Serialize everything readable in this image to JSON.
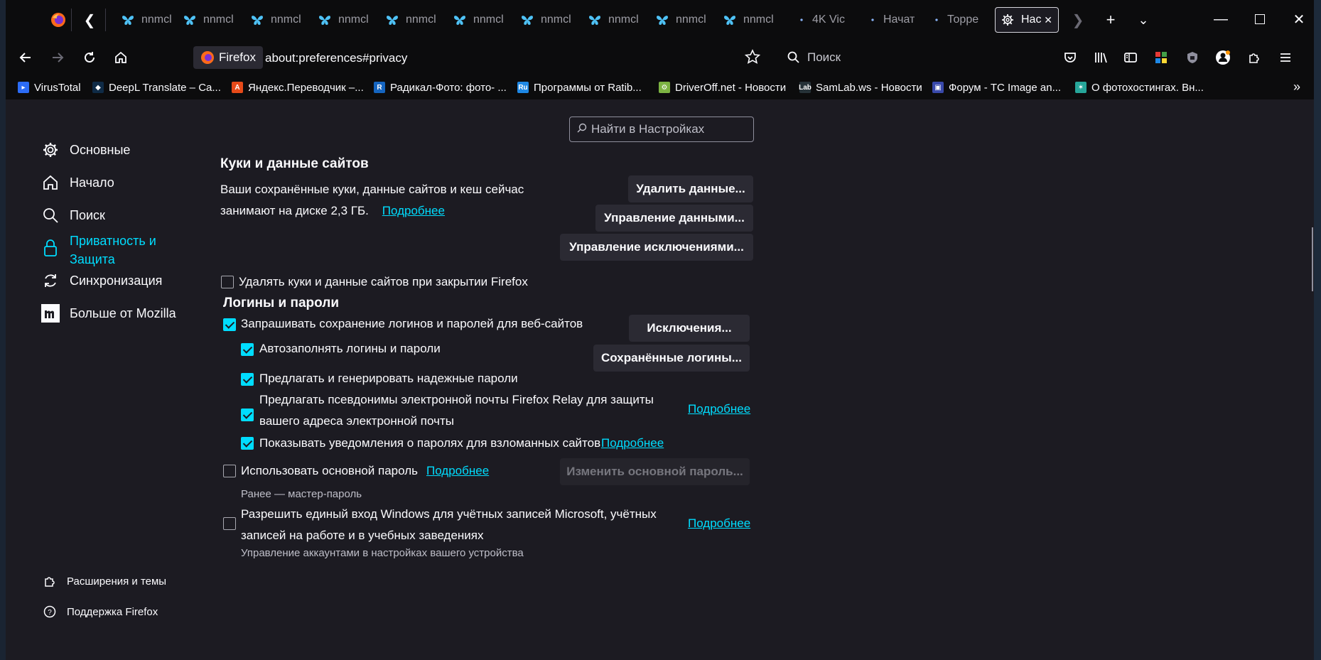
{
  "tabs": [
    {
      "label": "nnmcl",
      "icon": "butterfly-icon"
    },
    {
      "label": "nnmcl",
      "icon": "butterfly-icon"
    },
    {
      "label": "nnmcl",
      "icon": "butterfly-icon"
    },
    {
      "label": "nnmcl",
      "icon": "butterfly-icon"
    },
    {
      "label": "nnmcl",
      "icon": "butterfly-icon"
    },
    {
      "label": "nnmcl",
      "icon": "butterfly-icon"
    },
    {
      "label": "nnmcl",
      "icon": "butterfly-icon"
    },
    {
      "label": "nnmcl",
      "icon": "butterfly-icon"
    },
    {
      "label": "nnmcl",
      "icon": "butterfly-icon"
    },
    {
      "label": "nnmcl",
      "icon": "butterfly-icon"
    },
    {
      "label": "4K Vic",
      "icon": "dot-icon"
    },
    {
      "label": "Начат",
      "icon": "dot-icon"
    },
    {
      "label": "Торре",
      "icon": "dot-icon"
    },
    {
      "label": "Нас",
      "icon": "gear-icon"
    }
  ],
  "navbar": {
    "identity_label": "Firefox",
    "url": "about:preferences#privacy",
    "search_label": "Поиск"
  },
  "bookmarks": [
    {
      "label": "VirusTotal",
      "color": "#2c6cf6"
    },
    {
      "label": "DeepL Translate – Ca...",
      "color": "#0f2b46"
    },
    {
      "label": "Яндекс.Переводчик –...",
      "color": "#e64a19"
    },
    {
      "label": "Радикал-Фото: фото- ...",
      "color": "#1565c0"
    },
    {
      "label": "Программы от Ratib...",
      "color": "#1e88e5"
    },
    {
      "label": "DriverOff.net - Новости",
      "color": "#7cb342"
    },
    {
      "label": "SamLab.ws - Новости",
      "color": "#263238"
    },
    {
      "label": "Форум - TC Image an...",
      "color": "#3949ab"
    },
    {
      "label": "О фотохостингах. Вн...",
      "color": "#26a69a"
    }
  ],
  "sidebar": {
    "search_placeholder": "Найти в Настройках",
    "items": [
      {
        "label": "Основные",
        "icon": "gear-icon"
      },
      {
        "label": "Начало",
        "icon": "home-icon"
      },
      {
        "label": "Поиск",
        "icon": "search-icon"
      },
      {
        "label": "Приватность и Защита",
        "icon": "lock-icon"
      },
      {
        "label": "Синхронизация",
        "icon": "sync-icon"
      },
      {
        "label": "Больше от Mozilla",
        "icon": "mozilla-icon"
      }
    ],
    "footer": [
      {
        "label": "Расширения и темы",
        "icon": "puzzle-icon"
      },
      {
        "label": "Поддержка Firefox",
        "icon": "help-icon"
      }
    ]
  },
  "cookies": {
    "title": "Куки и данные сайтов",
    "desc_line1": "Ваши сохранённые куки, данные сайтов и кеш сейчас",
    "desc_line2": "занимают на диске 2,3 ГБ.",
    "learn_more": "Подробнее",
    "delete_on_close": "Удалять куки и данные сайтов при закрытии Firefox",
    "clear_data_btn": "Удалить данные...",
    "manage_data_btn": "Управление данными...",
    "manage_exceptions_btn": "Управление исключениями..."
  },
  "logins": {
    "title": "Логины и пароли",
    "ask_save": "Запрашивать сохранение логинов и паролей для веб-сайтов",
    "exceptions_btn": "Исключения...",
    "autofill": "Автозаполнять логины и пароли",
    "saved_logins_btn": "Сохранённые логины...",
    "suggest_passwords": "Предлагать и генерировать надежные пароли",
    "relay_line1": "Предлагать псевдонимы электронной почты Firefox Relay для защиты",
    "relay_line2": "вашего адреса электронной почты",
    "relay_more": "Подробнее",
    "breach_alerts": "Показывать уведомления о паролях для взломанных сайтов",
    "breach_more": "Подробнее",
    "primary_password": "Использовать основной пароль",
    "primary_more": "Подробнее",
    "change_primary_btn": "Изменить основной пароль...",
    "formerly": "Ранее — мастер-пароль",
    "windows_sso_line1": "Разрешить единый вход Windows для учётных записей Microsoft, учётных",
    "windows_sso_line2": "записей на работе и в учебных заведениях",
    "windows_more": "Подробнее",
    "cut_line": "Управление аккаунтами в настройках вашего устройства"
  }
}
